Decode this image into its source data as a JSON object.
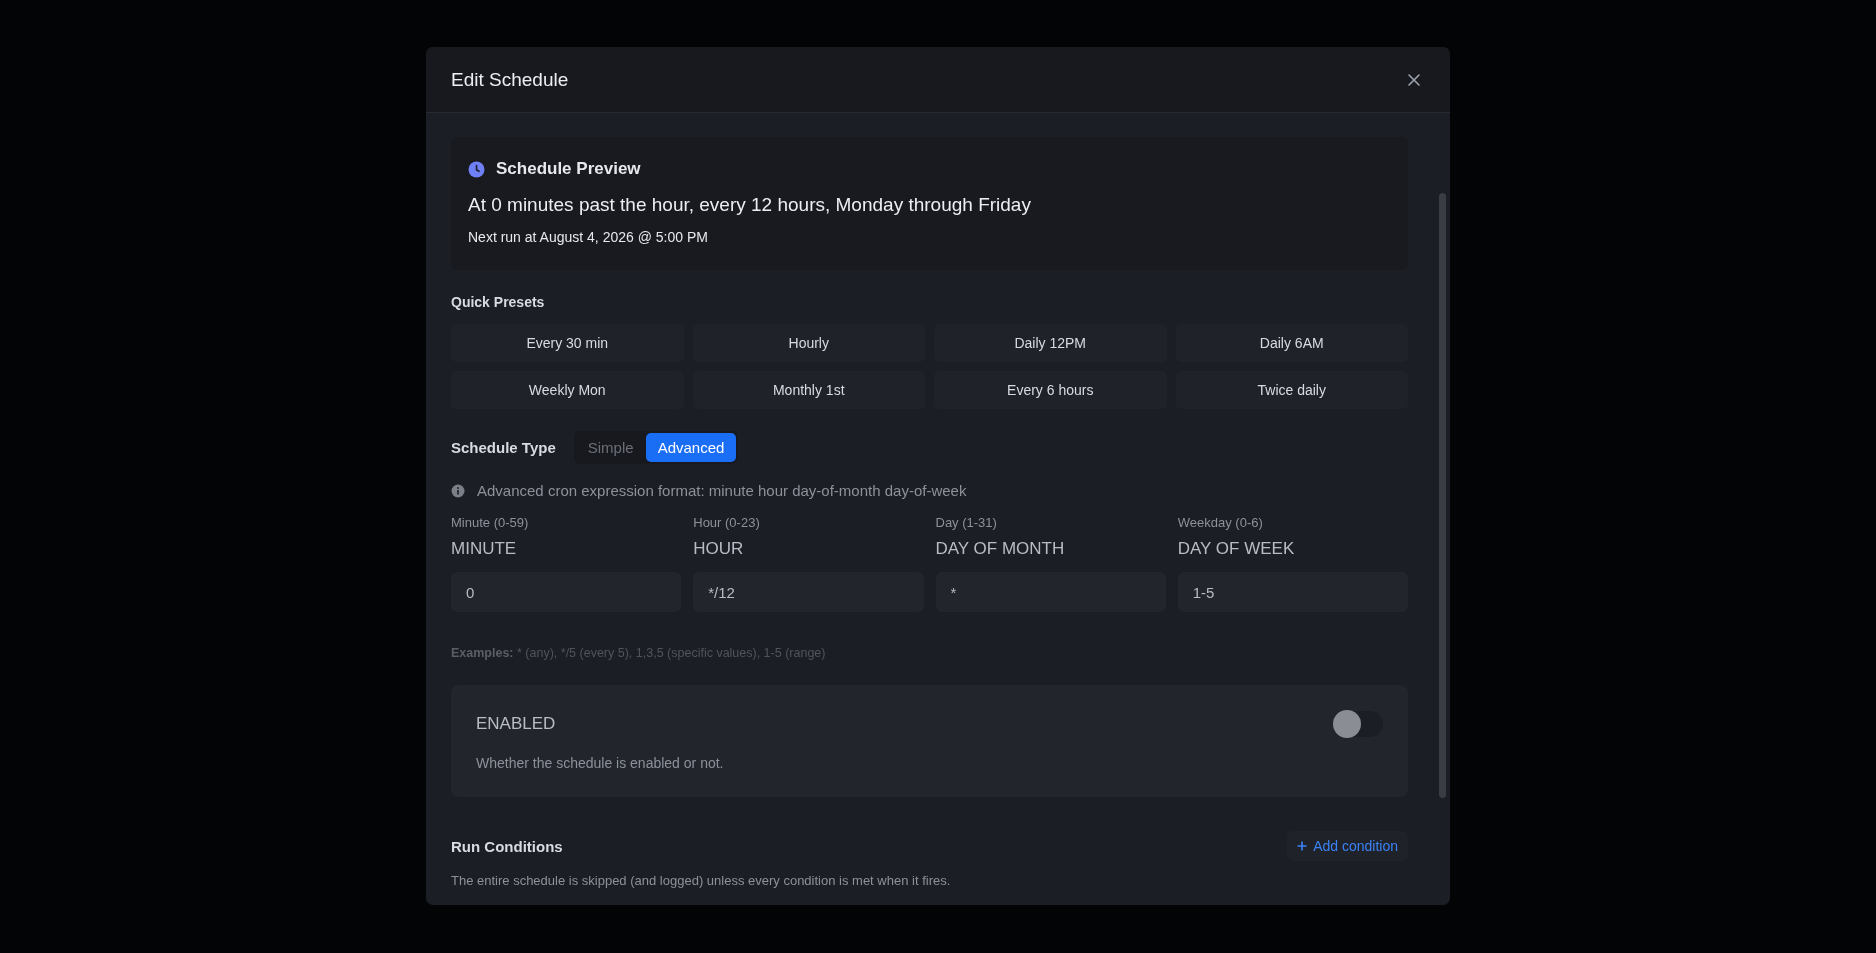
{
  "dialog": {
    "title": "Edit Schedule",
    "preview": {
      "title": "Schedule Preview",
      "description": "At 0 minutes past the hour, every 12 hours, Monday through Friday",
      "next_run": "Next run at August 4, 2026 @ 5:00 PM"
    },
    "presets": {
      "label": "Quick Presets",
      "items": [
        "Every 30 min",
        "Hourly",
        "Daily 12PM",
        "Daily 6AM",
        "Weekly Mon",
        "Monthly 1st",
        "Every 6 hours",
        "Twice daily"
      ]
    },
    "schedule_type": {
      "label": "Schedule Type",
      "options": [
        {
          "label": "Simple",
          "selected": false
        },
        {
          "label": "Advanced",
          "selected": true
        }
      ]
    },
    "info": "Advanced cron expression format: minute hour day-of-month day-of-week",
    "fields": [
      {
        "hint": "Minute (0-59)",
        "label": "MINUTE",
        "value": "0"
      },
      {
        "hint": "Hour (0-23)",
        "label": "HOUR",
        "value": "*/12"
      },
      {
        "hint": "Day (1-31)",
        "label": "DAY OF MONTH",
        "value": "*"
      },
      {
        "hint": "Weekday (0-6)",
        "label": "DAY OF WEEK",
        "value": "1-5"
      }
    ],
    "examples": {
      "label": "Examples:",
      "text": "* (any), */5 (every 5), 1,3,5 (specific values), 1-5 (range)"
    },
    "enabled": {
      "label": "ENABLED",
      "description": "Whether the schedule is enabled or not.",
      "on": false
    },
    "run_conditions": {
      "title": "Run Conditions",
      "add_button": "Add condition",
      "description": "The entire schedule is skipped (and logged) unless every condition is met when it fires."
    }
  }
}
